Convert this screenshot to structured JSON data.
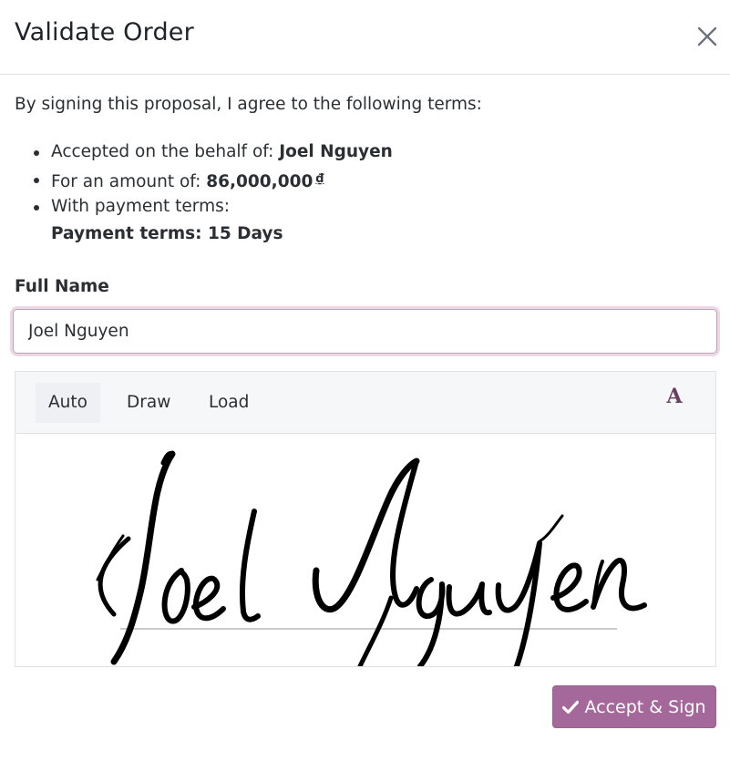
{
  "dialog": {
    "title": "Validate Order",
    "close_icon": "close-icon"
  },
  "body": {
    "intro": "By signing this proposal, I agree to the following terms:",
    "terms": {
      "behalf_label": "Accepted on the behalf of: ",
      "behalf_value": "Joel Nguyen",
      "amount_label": "For an amount of: ",
      "amount_value": "86,000,000",
      "currency": "₫",
      "payment_label": "With payment terms:",
      "payment_value": "Payment terms: 15 Days"
    }
  },
  "form": {
    "full_name_label": "Full Name",
    "full_name_value": "Joel Nguyen"
  },
  "signature": {
    "tabs": [
      {
        "label": "Auto",
        "active": true
      },
      {
        "label": "Draw",
        "active": false
      },
      {
        "label": "Load",
        "active": false
      }
    ],
    "font_button": "A",
    "font_icon": "font-selector-icon",
    "signed_name": "Joel Nguyen"
  },
  "actions": {
    "accept_label": "Accept & Sign",
    "accept_icon": "check-icon"
  },
  "colors": {
    "primary": "#a5689a",
    "focus_ring": "#ead9e5",
    "font_icon": "#6b3f63"
  }
}
